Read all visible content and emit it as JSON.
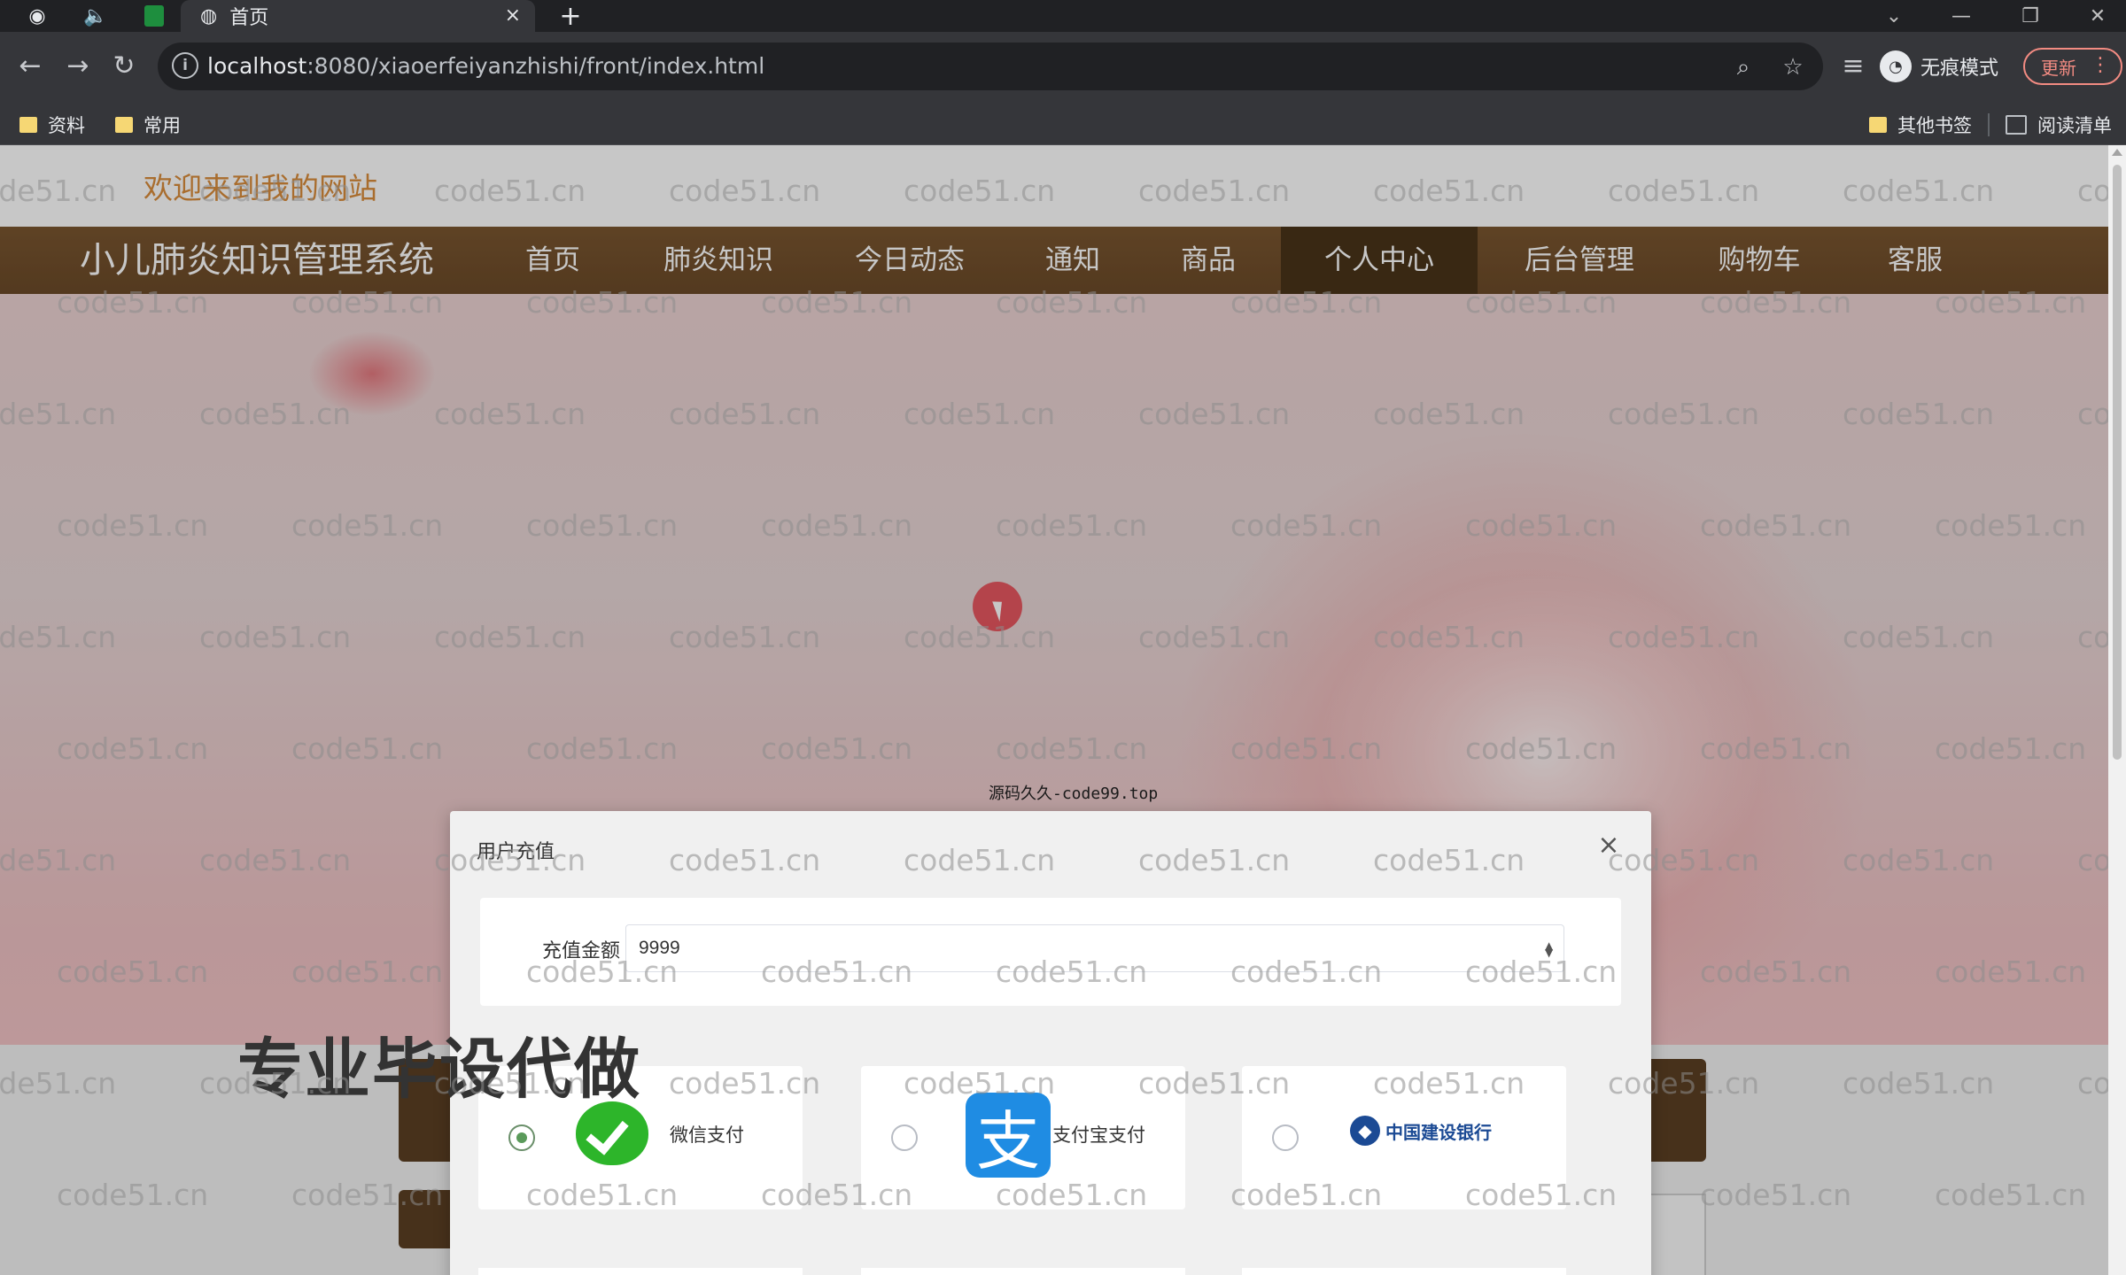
{
  "browser": {
    "tab_title": "首页",
    "tab_close": "×",
    "new_tab": "+",
    "url_host": "localhost",
    "url_path": ":8080/xiaoerfeiyanzhishi/front/index.html",
    "incognito_label": "无痕模式",
    "update_label": "更新",
    "bookmarks": [
      {
        "label": "资料"
      },
      {
        "label": "常用"
      }
    ],
    "other_bookmarks": "其他书签",
    "reading_list": "阅读清单"
  },
  "site": {
    "welcome": "欢迎来到我的网站",
    "title": "小儿肺炎知识管理系统",
    "nav": [
      {
        "label": "首页"
      },
      {
        "label": "肺炎知识"
      },
      {
        "label": "今日动态"
      },
      {
        "label": "通知"
      },
      {
        "label": "商品"
      },
      {
        "label": "个人中心",
        "active": true
      },
      {
        "label": "后台管理"
      },
      {
        "label": "购物车"
      },
      {
        "label": "客服"
      }
    ],
    "banner_caption": "源码久久-code99.top",
    "promo_text": "专业毕设代做"
  },
  "dialog": {
    "title": "用户充值",
    "close": "×",
    "amount_label": "充值金额",
    "amount_value": "9999",
    "payment_methods": [
      {
        "label": "微信支付",
        "selected": true,
        "icon": "wechat-pay-icon"
      },
      {
        "label": "支付宝支付",
        "selected": false,
        "icon": "alipay-icon"
      },
      {
        "label": "中国建设银行",
        "selected": false,
        "icon": "ccb-bank-icon"
      }
    ]
  },
  "watermark_text": "code51.cn",
  "colors": {
    "navbar": "#6b4a28",
    "nav_active": "#4a3419",
    "welcome": "#d98c3b",
    "wechat": "#2db52a",
    "alipay": "#1f8ce3",
    "ccb": "#1b4a94"
  }
}
